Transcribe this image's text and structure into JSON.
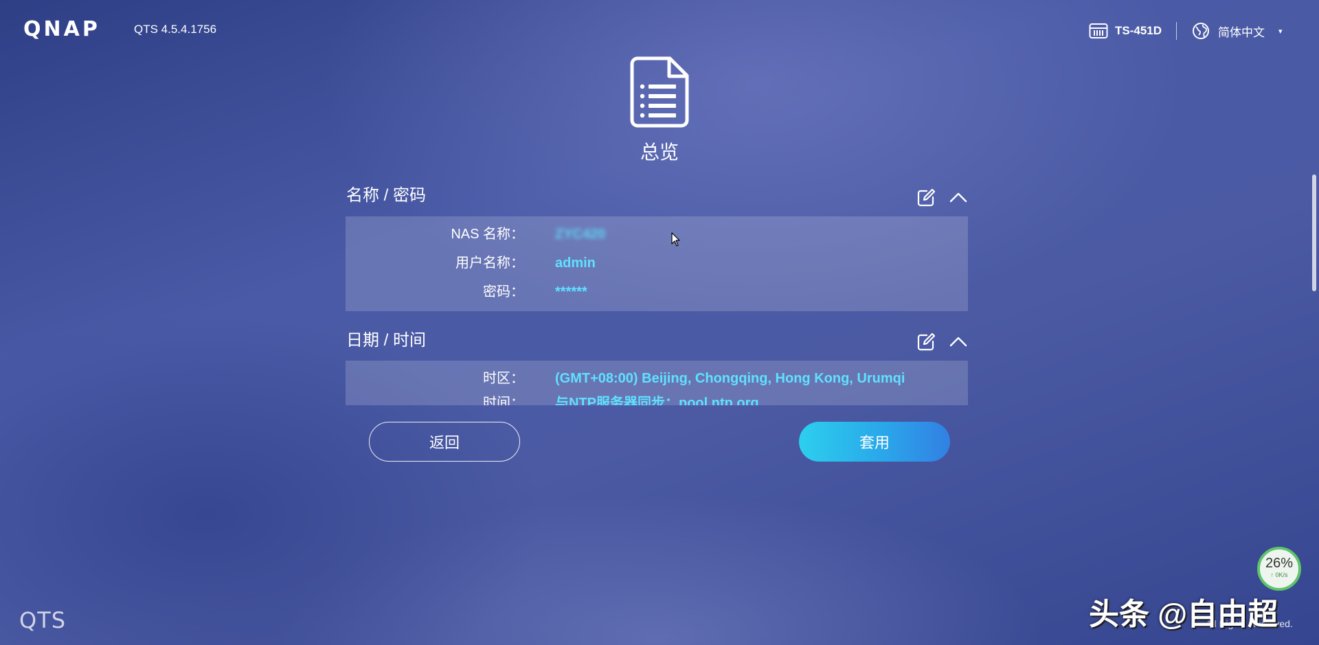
{
  "header": {
    "logo": "QNAP",
    "version": "QTS 4.5.4.1756",
    "model": "TS-451D",
    "model_icon": "nas-device-icon",
    "language": "简体中文",
    "language_icon": "globe-icon",
    "language_caret": "▾"
  },
  "page": {
    "title": "总览",
    "icon": "document-list-icon"
  },
  "sections": {
    "name_password": {
      "title": "名称 / 密码",
      "rows": [
        {
          "label": "NAS 名称：",
          "value": "ZYC420"
        },
        {
          "label": "用户名称：",
          "value": "admin"
        },
        {
          "label": "密码：",
          "value": "******"
        }
      ]
    },
    "date_time": {
      "title": "日期 / 时间",
      "rows": [
        {
          "label": "时区：",
          "value": "(GMT+08:00) Beijing, Chongqing, Hong Kong, Urumqi"
        },
        {
          "label": "时间：",
          "value": "与NTP服务器同步：pool.ntp.org"
        }
      ]
    }
  },
  "buttons": {
    "back": "返回",
    "apply": "套用"
  },
  "footer": {
    "qts": "QTS",
    "copyright": "All Rights Reserved.",
    "watermark": "头条 @自由超"
  },
  "speed_widget": {
    "percent": "26%",
    "rate": "↑ 0K/s"
  },
  "colors": {
    "accent_value": "#5fe1ff",
    "apply_gradient_start": "#2ccfee",
    "apply_gradient_end": "#3280e3",
    "background": "#4a5aa6"
  }
}
